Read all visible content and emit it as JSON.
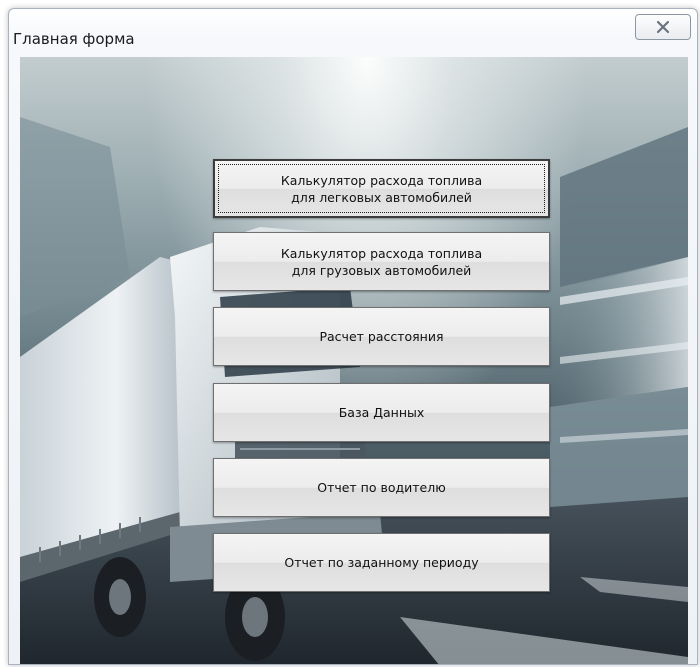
{
  "window": {
    "title": "Главная форма",
    "close_icon": "close-x-icon"
  },
  "buttons": [
    {
      "label": "Калькулятор расхода топлива\nдля легковых автомобилей",
      "focused": true
    },
    {
      "label": "Калькулятор расхода топлива\nдля грузовых автомобилей",
      "focused": false
    },
    {
      "label": "Расчет расстояния",
      "focused": false
    },
    {
      "label": "База Данных",
      "focused": false
    },
    {
      "label": "Отчет по водителю",
      "focused": false
    },
    {
      "label": "Отчет по заданному периоду",
      "focused": false
    }
  ],
  "colors": {
    "button_face": "#e9e9e9",
    "button_border": "#707070",
    "window_frame": "#a9b3bf"
  }
}
